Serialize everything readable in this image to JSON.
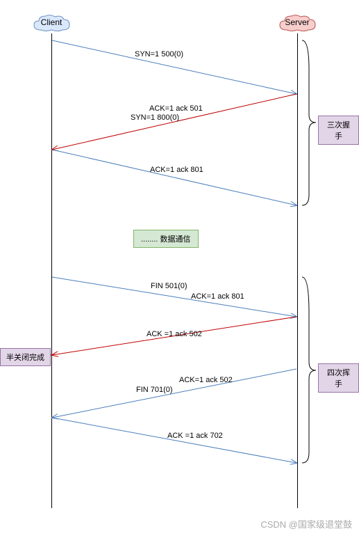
{
  "nodes": {
    "client": "Client",
    "server": "Server"
  },
  "messages": {
    "m1": "SYN=1 500(0)",
    "m2a": "ACK=1 ack  501",
    "m2b": "SYN=1 800(0)",
    "m3": "ACK=1 ack 801",
    "data": "........  数据通信",
    "m4a": "FIN 501(0)",
    "m4b": "ACK=1 ack 801",
    "m5": "ACK =1 ack 502",
    "m6a": "ACK=1 ack 502",
    "m6b": "FIN 701(0)",
    "m7": "ACK =1 ack 702"
  },
  "annotations": {
    "three_way": "三次握手",
    "four_way": "四次挥手",
    "half_close": "半关闭完成"
  },
  "watermark": "CSDN @国家级退堂鼓",
  "chart_data": {
    "type": "sequence-diagram",
    "participants": [
      "Client",
      "Server"
    ],
    "phases": [
      {
        "name": "三次握手",
        "messages": [
          {
            "from": "Client",
            "to": "Server",
            "label": "SYN=1 500(0)",
            "color": "blue"
          },
          {
            "from": "Server",
            "to": "Client",
            "label": "ACK=1 ack 501 / SYN=1 800(0)",
            "color": "red"
          },
          {
            "from": "Client",
            "to": "Server",
            "label": "ACK=1 ack 801",
            "color": "blue"
          }
        ]
      },
      {
        "name": "数据通信",
        "messages": []
      },
      {
        "name": "四次挥手",
        "messages": [
          {
            "from": "Client",
            "to": "Server",
            "label": "FIN 501(0) / ACK=1 ack 801",
            "color": "blue"
          },
          {
            "from": "Server",
            "to": "Client",
            "label": "ACK=1 ack 502",
            "color": "red",
            "note": "半关闭完成"
          },
          {
            "from": "Server",
            "to": "Client",
            "label": "ACK=1 ack 502 / FIN 701(0)",
            "color": "blue"
          },
          {
            "from": "Client",
            "to": "Server",
            "label": "ACK=1 ack 702",
            "color": "blue"
          }
        ]
      }
    ]
  }
}
